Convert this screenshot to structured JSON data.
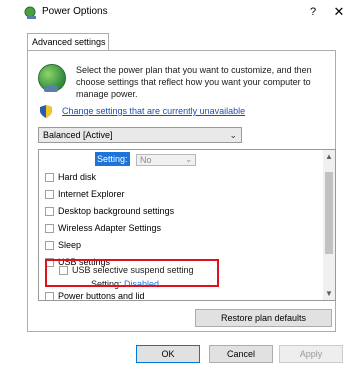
{
  "window": {
    "title": "Power Options",
    "help_glyph": "?",
    "close_glyph": "✕",
    "icon": "power-options-icon"
  },
  "tabs": [
    {
      "label": "Advanced settings",
      "active": true
    }
  ],
  "intro": {
    "text": "Select the power plan that you want to customize, and then choose settings that reflect how you want your computer to manage power.",
    "icon": "power-globe-icon"
  },
  "change_settings_link": {
    "text": "Change settings that are currently unavailable",
    "icon": "shield-icon"
  },
  "plan_dropdown": {
    "selected": "Balanced [Active]"
  },
  "tree": {
    "top_setting": {
      "label": "Setting:",
      "value": "No"
    },
    "items": [
      "Hard disk",
      "Internet Explorer",
      "Desktop background settings",
      "Wireless Adapter Settings",
      "Sleep",
      "USB settings"
    ],
    "usb_child": "USB selective suspend setting",
    "usb_setting": {
      "label": "Setting:",
      "value": "Disabled"
    },
    "bottom_item": "Power buttons and lid"
  },
  "buttons": {
    "restore": "Restore plan defaults",
    "ok": "OK",
    "cancel": "Cancel",
    "apply": "Apply"
  },
  "colors": {
    "accent": "#1e74d6",
    "highlight_border": "#e0101c",
    "link": "#1a4fb8"
  }
}
